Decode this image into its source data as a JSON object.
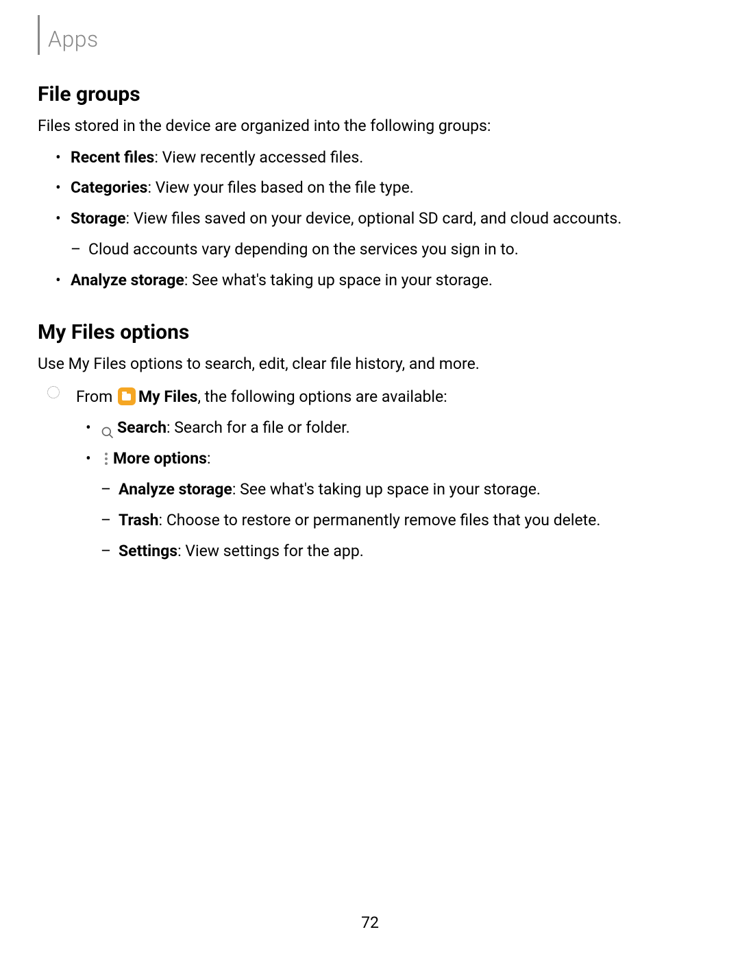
{
  "header": {
    "title": "Apps"
  },
  "sections": {
    "fileGroups": {
      "heading": "File groups",
      "intro": "Files stored in the device are organized into the following groups:",
      "items": {
        "recentFiles": {
          "label": "Recent files",
          "desc": ": View recently accessed files."
        },
        "categories": {
          "label": "Categories",
          "desc": ": View your files based on the file type."
        },
        "storage": {
          "label": "Storage",
          "desc": ": View files saved on your device, optional SD card, and cloud accounts.",
          "subItems": {
            "cloud": "Cloud accounts vary depending on the services you sign in to."
          }
        },
        "analyzeStorage": {
          "label": "Analyze storage",
          "desc": ": See what's taking up space in your storage."
        }
      }
    },
    "myFilesOptions": {
      "heading": "My Files options",
      "intro": "Use My Files options to search, edit, clear file history, and more.",
      "fromText": "From ",
      "myFilesLabel": "My Files",
      "fromSuffix": ", the following options are available:",
      "options": {
        "search": {
          "label": "Search",
          "desc": ": Search for a file or folder."
        },
        "moreOptions": {
          "label": "More options",
          "desc": ":",
          "subItems": {
            "analyzeStorage": {
              "label": "Analyze storage",
              "desc": ": See what's taking up space in your storage."
            },
            "trash": {
              "label": "Trash",
              "desc": ": Choose to restore or permanently remove files that you delete."
            },
            "settings": {
              "label": "Settings",
              "desc": ": View settings for the app."
            }
          }
        }
      }
    }
  },
  "pageNumber": "72"
}
